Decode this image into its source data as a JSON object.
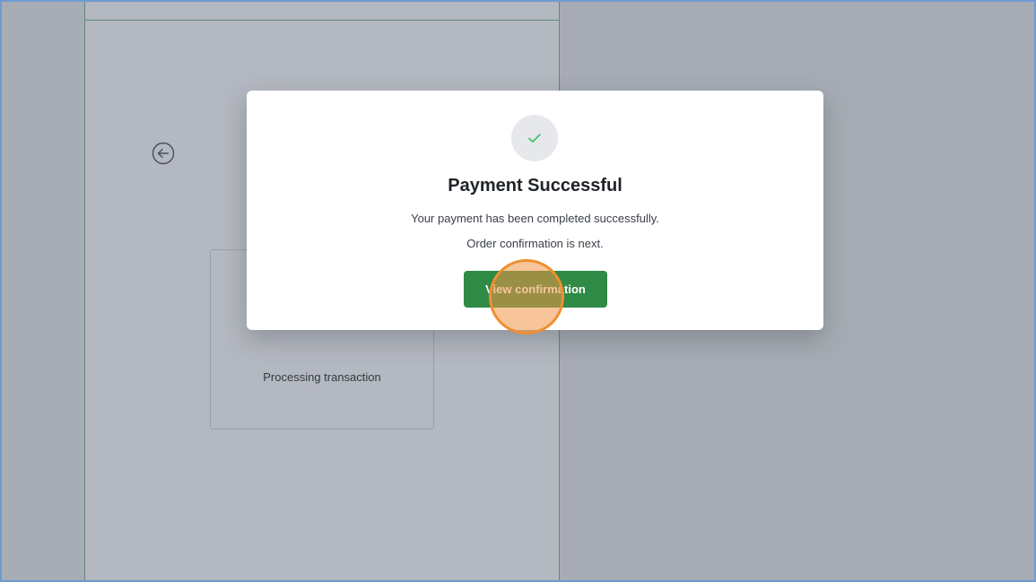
{
  "modal": {
    "title": "Payment Successful",
    "message_line1": "Your payment has been completed successfully.",
    "message_line2": "Order confirmation is next.",
    "primary_button_label": "View confirmation",
    "status_icon": "check-icon"
  },
  "background_page": {
    "back_icon": "arrow-left-circle-icon",
    "card_status_text": "Processing transaction"
  },
  "colors": {
    "primary_button": "#2f8a45",
    "check_mark": "#3bbf6a",
    "click_marker": "#ef8f2f",
    "overlay": "#a7acb4",
    "frame_border": "#6f9bd1"
  }
}
